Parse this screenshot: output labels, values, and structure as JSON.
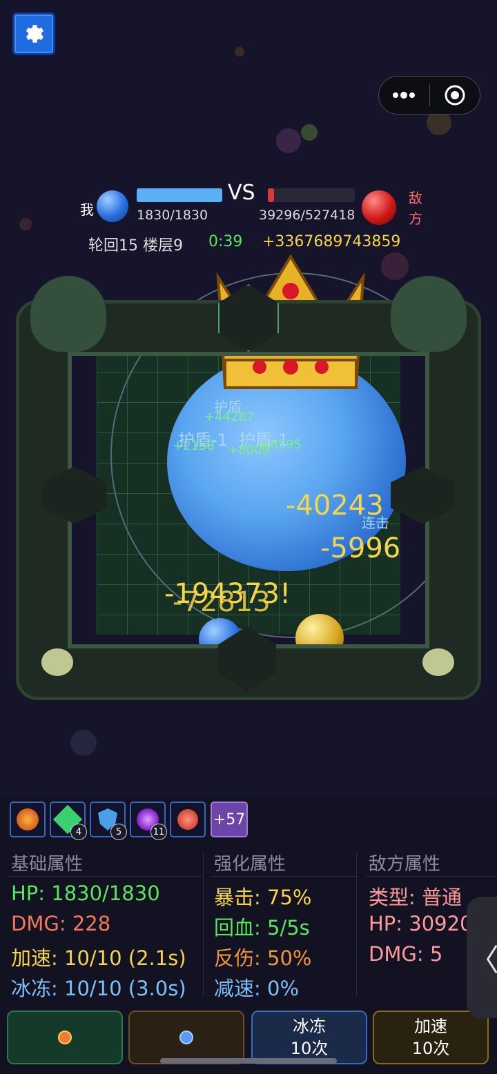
{
  "hud": {
    "me_label": "我",
    "enemy_label": "敌方",
    "vs": "VS",
    "my_hp": "1830/1830",
    "enemy_hp": "39296/527418",
    "enemy_hp_fraction": 0.075,
    "my_hp_fraction": 1.0,
    "cycle_floor": "轮回15 楼层9",
    "timer": "0:39",
    "gold_gain": "+3367689743859"
  },
  "arena": {
    "floating_texts": {
      "shield_1": "护盾",
      "heal_1": "+44287",
      "shield_2": "护盾-1",
      "shield_3": "护盾-1",
      "heal_2": "+2158",
      "heal_3": "+8009",
      "heal_4": "+6595",
      "damage_1": "-40243",
      "damage_2": "-5996",
      "combo": "连击",
      "damage_3": "-194373!",
      "damage_4": "-72813"
    }
  },
  "skills": {
    "slots": [
      {
        "icon": "fire-dragon-icon",
        "count": ""
      },
      {
        "icon": "green-crystal-icon",
        "count": "4"
      },
      {
        "icon": "blue-shield-icon",
        "count": "5"
      },
      {
        "icon": "purple-vortex-icon",
        "count": "11"
      },
      {
        "icon": "red-rose-icon",
        "count": ""
      }
    ],
    "more_label": "+57"
  },
  "stats": {
    "basic": {
      "title": "基础属性",
      "hp": "HP: 1830/1830",
      "dmg": "DMG: 228",
      "speed": "加速: 10/10 (2.1s)",
      "freeze": "冰冻: 10/10 (3.0s)"
    },
    "enhanced": {
      "title": "强化属性",
      "crit": "暴击: 75%",
      "regen": "回血: 5/5s",
      "reflect": "反伤: 50%",
      "slow": "减速: 0%"
    },
    "enemy": {
      "title": "敌方属性",
      "type": "类型: 普通",
      "hp": "HP: 30920",
      "dmg": "DMG: 5"
    }
  },
  "buttons": {
    "freeze_label": "冰冻",
    "freeze_count": "10次",
    "speed_label": "加速",
    "speed_count": "10次"
  },
  "side_tab": "〈",
  "colors": {
    "accent_blue": "#1f6be0",
    "hp_me": "#5aaff5",
    "hp_enemy": "#d83a3a",
    "gold_text": "#f5d54a",
    "green_text": "#5ce65c"
  }
}
